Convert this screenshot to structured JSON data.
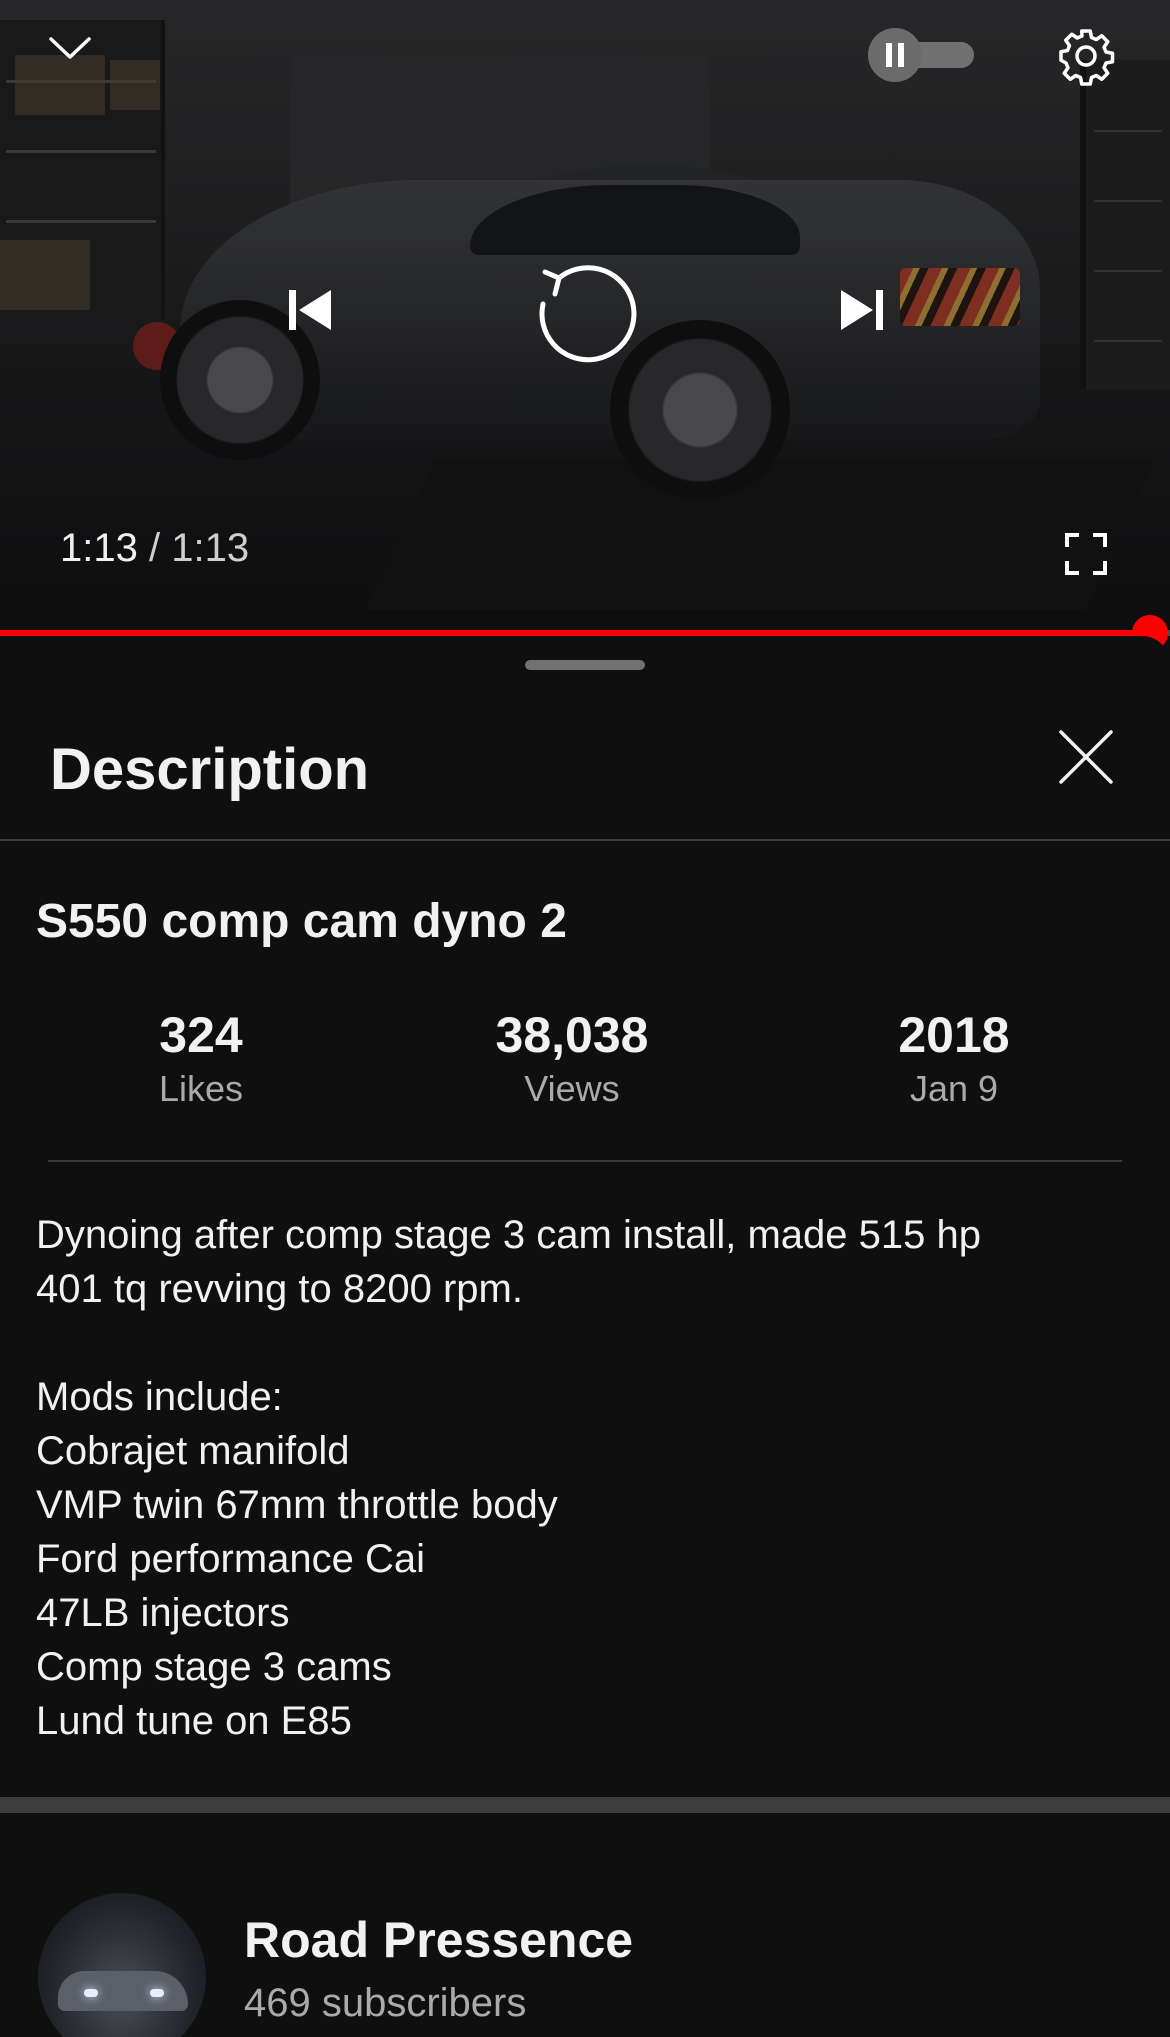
{
  "player": {
    "current_time": "1:13",
    "separator": "/",
    "duration": "1:13",
    "progress": 1.0,
    "autoplay": "on",
    "icons": {
      "collapse": "chevron-down-icon",
      "autoplay": "pause-icon",
      "settings": "gear-icon",
      "previous": "skip-previous-icon",
      "replay": "replay-icon",
      "next": "skip-next-icon",
      "fullscreen": "fullscreen-icon"
    },
    "accent_color": "#ff0000"
  },
  "sheet": {
    "title": "Description",
    "close_icon": "close-icon"
  },
  "video": {
    "title": "S550 comp cam dyno 2",
    "stats": [
      {
        "value": "324",
        "label": "Likes"
      },
      {
        "value": "38,038",
        "label": "Views"
      },
      {
        "value": "2018",
        "label": "Jan 9"
      }
    ],
    "description": "Dynoing  after comp stage 3 cam install, made 515 hp\n401 tq revving to 8200 rpm.\n\nMods include:\nCobrajet manifold\nVMP twin 67mm throttle body\nFord performance Cai\n47LB injectors\nComp stage 3 cams\nLund tune on E85"
  },
  "channel": {
    "name": "Road Pressence",
    "subscribers": "469 subscribers"
  }
}
